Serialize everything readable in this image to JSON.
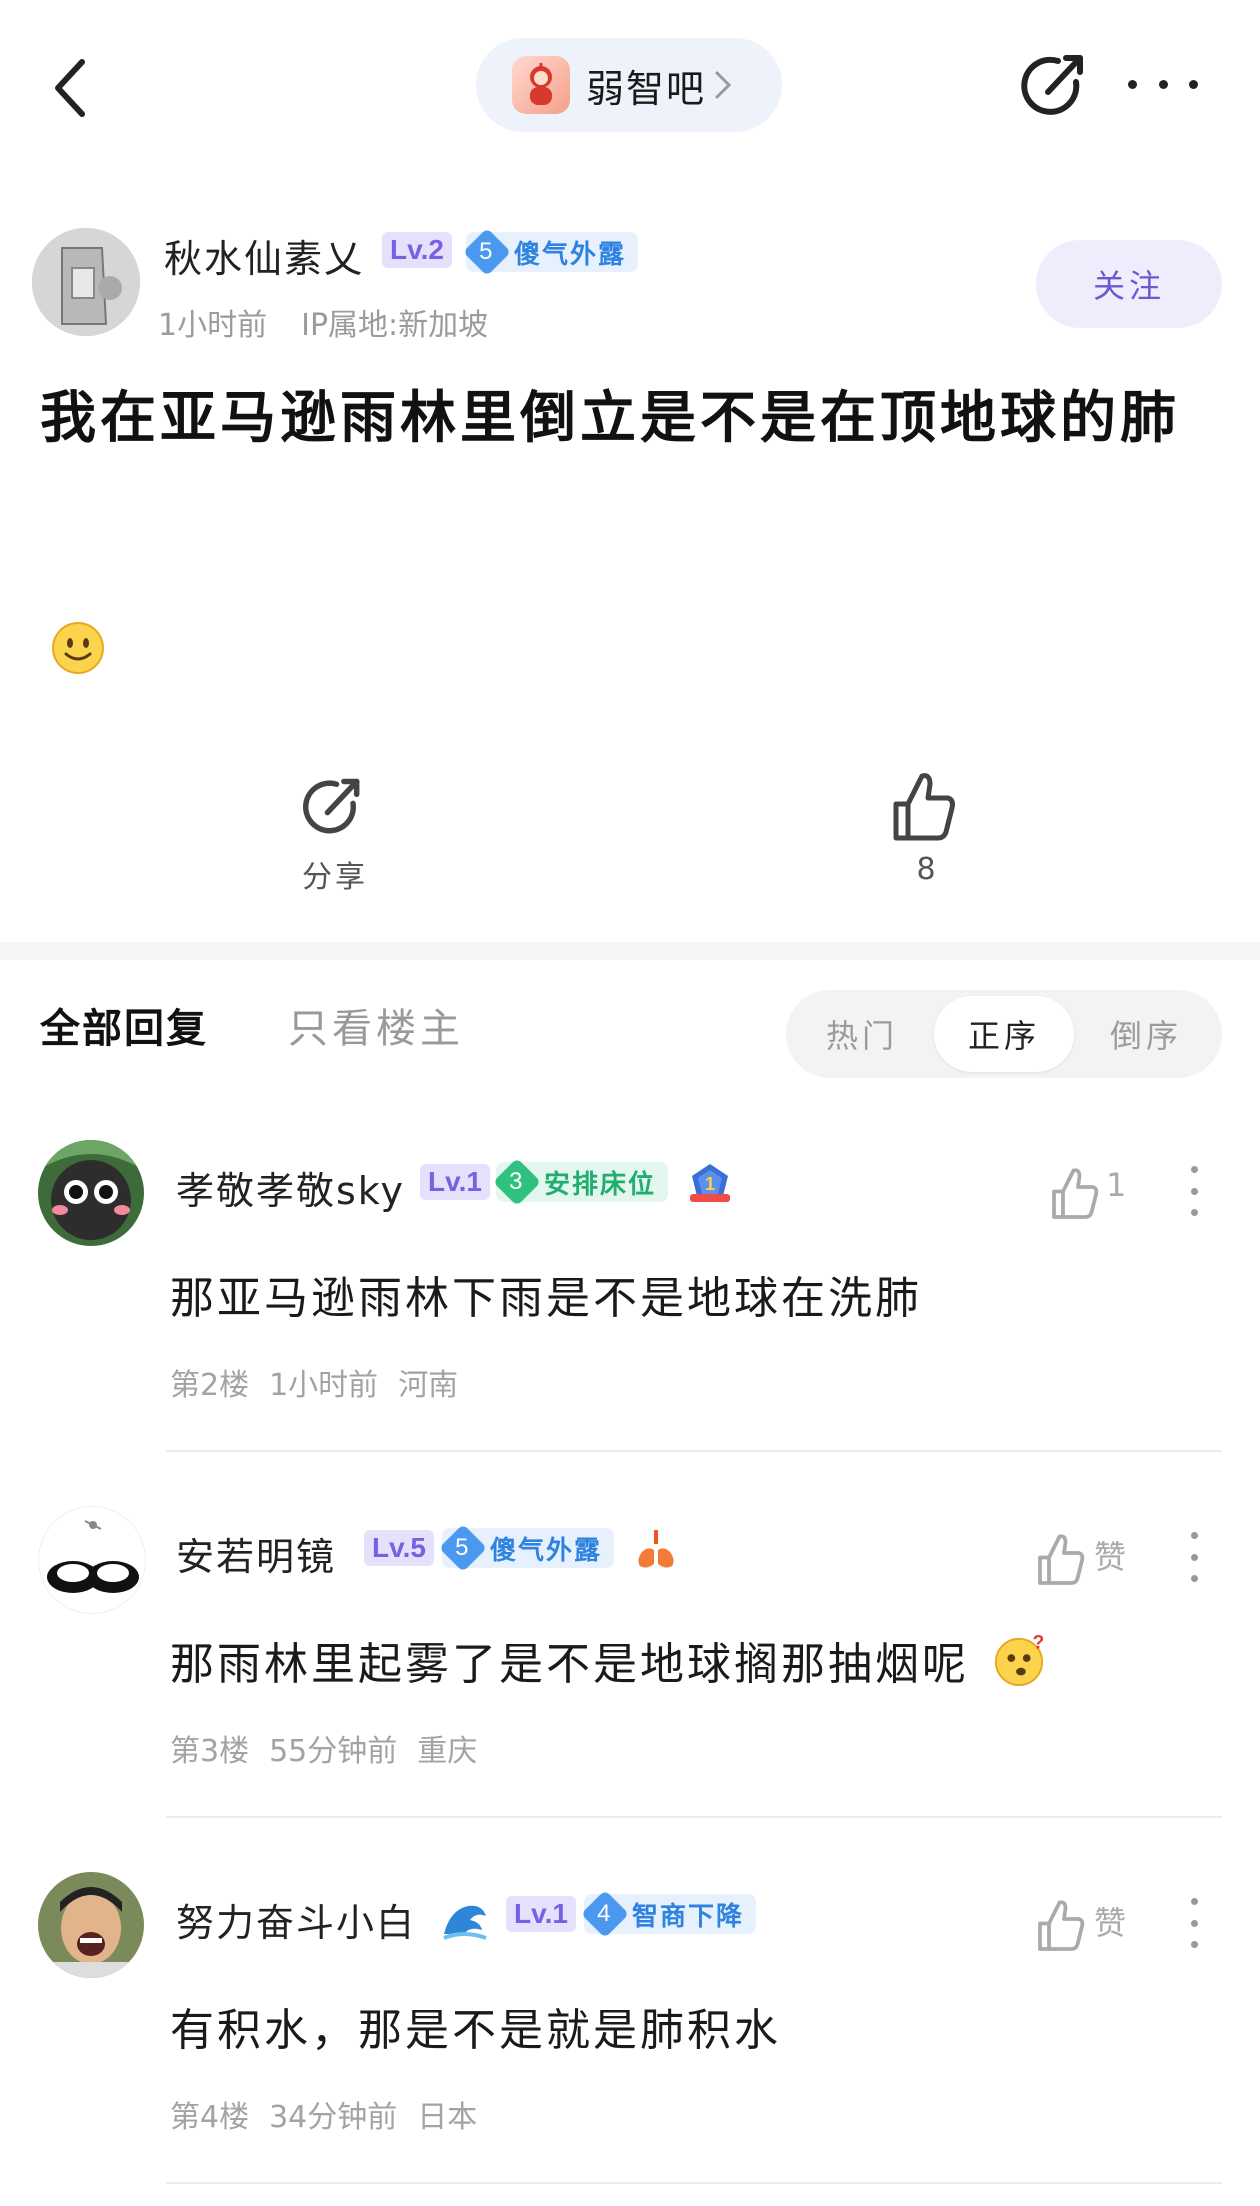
{
  "header": {
    "forum_name": "弱智吧",
    "icons": [
      "back-chevron-icon",
      "forum-logo-icon",
      "chevron-right-icon",
      "share-icon",
      "more-icon"
    ]
  },
  "post": {
    "author": {
      "name": "秋水仙素乂",
      "level": "Lv.2",
      "badge_number": "5",
      "badge_text": "傻气外露",
      "time": "1小时前",
      "ip": "IP属地:新加坡"
    },
    "follow_label": "关注",
    "title": "我在亚马逊雨林里倒立是不是在顶地球的肺",
    "emoji": "smiley-emoji",
    "share_label": "分享",
    "like_count": "8"
  },
  "tabs": {
    "all_replies": "全部回复",
    "op_only": "只看楼主",
    "sort": [
      {
        "label": "热门",
        "active": false
      },
      {
        "label": "正序",
        "active": true
      },
      {
        "label": "倒序",
        "active": false
      }
    ]
  },
  "replies": [
    {
      "name": "孝敬孝敬sky",
      "level": "Lv.1",
      "badge_number": "3",
      "badge_text": "安排床位",
      "badge_color": "green",
      "medal": "rank-1-medal-icon",
      "like_label": "1",
      "text": "那亚马逊雨林下雨是不是地球在洗肺",
      "floor": "第2楼",
      "time": "1小时前",
      "location": "河南"
    },
    {
      "name": "安若明镜",
      "level": "Lv.5",
      "badge_number": "5",
      "badge_text": "傻气外露",
      "badge_color": "blue",
      "medal": "lungs-icon",
      "like_label": "赞",
      "text": "那雨林里起雾了是不是地球搁那抽烟呢",
      "emoji": "thinking-emoji",
      "floor": "第3楼",
      "time": "55分钟前",
      "location": "重庆"
    },
    {
      "name": "努力奋斗小白",
      "name_icon": "wave-icon",
      "level": "Lv.1",
      "badge_number": "4",
      "badge_text": "智商下降",
      "badge_color": "blue",
      "like_label": "赞",
      "text": "有积水，那是不是就是肺积水",
      "floor": "第4楼",
      "time": "34分钟前",
      "location": "日本"
    }
  ],
  "colors": {
    "accent_purple": "#6a5acd",
    "level_bg": "#e5e0fb",
    "badge_blue": "#2f83e0",
    "badge_green": "#1fae6e"
  }
}
